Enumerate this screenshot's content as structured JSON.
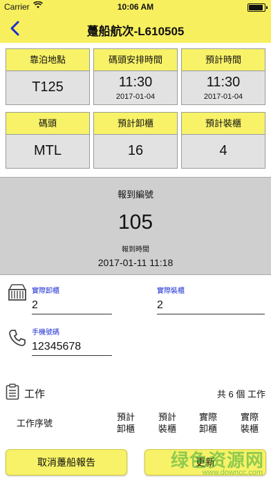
{
  "status_bar": {
    "carrier": "Carrier",
    "time": "10:06 AM",
    "battery_level": 1.0
  },
  "nav": {
    "title": "躉船航次-L610505"
  },
  "info_cards": {
    "berth": {
      "label": "靠泊地點",
      "value": "T125"
    },
    "pier_time": {
      "label": "碼頭安排時間",
      "time": "11:30",
      "date": "2017-01-04"
    },
    "eta": {
      "label": "預計時間",
      "time": "11:30",
      "date": "2017-01-04"
    },
    "pier": {
      "label": "碼頭",
      "value": "MTL"
    },
    "est_unload": {
      "label": "預計卸櫃",
      "value": "16"
    },
    "est_load": {
      "label": "預計裝櫃",
      "value": "4"
    }
  },
  "report": {
    "label": "報到編號",
    "number": "105",
    "time_label": "報到時間",
    "time_value": "2017-01-11 11:18"
  },
  "fields": {
    "actual_unload": {
      "label": "實際卸櫃",
      "value": "2"
    },
    "actual_load": {
      "label": "實際裝櫃",
      "value": "2"
    },
    "phone": {
      "label": "手機號碼",
      "value": "12345678"
    }
  },
  "work": {
    "title": "工作",
    "count": "共 6 個 工作",
    "columns": {
      "seq": "工作序號",
      "est_unload_1": "預計",
      "est_unload_2": "卸櫃",
      "est_load_1": "預計",
      "est_load_2": "裝櫃",
      "act_unload_1": "實際",
      "act_unload_2": "卸櫃",
      "act_load_1": "實際",
      "act_load_2": "裝櫃"
    }
  },
  "buttons": {
    "cancel": "取消躉船報告",
    "update": "更新"
  },
  "watermark": {
    "text": "绿色资源网",
    "url": "www.downcc.com"
  },
  "colors": {
    "accent_yellow": "#f7ef5e",
    "header_cell": "#f7f267",
    "label_blue": "#1a2bd1",
    "back_blue": "#1a2bd1"
  }
}
